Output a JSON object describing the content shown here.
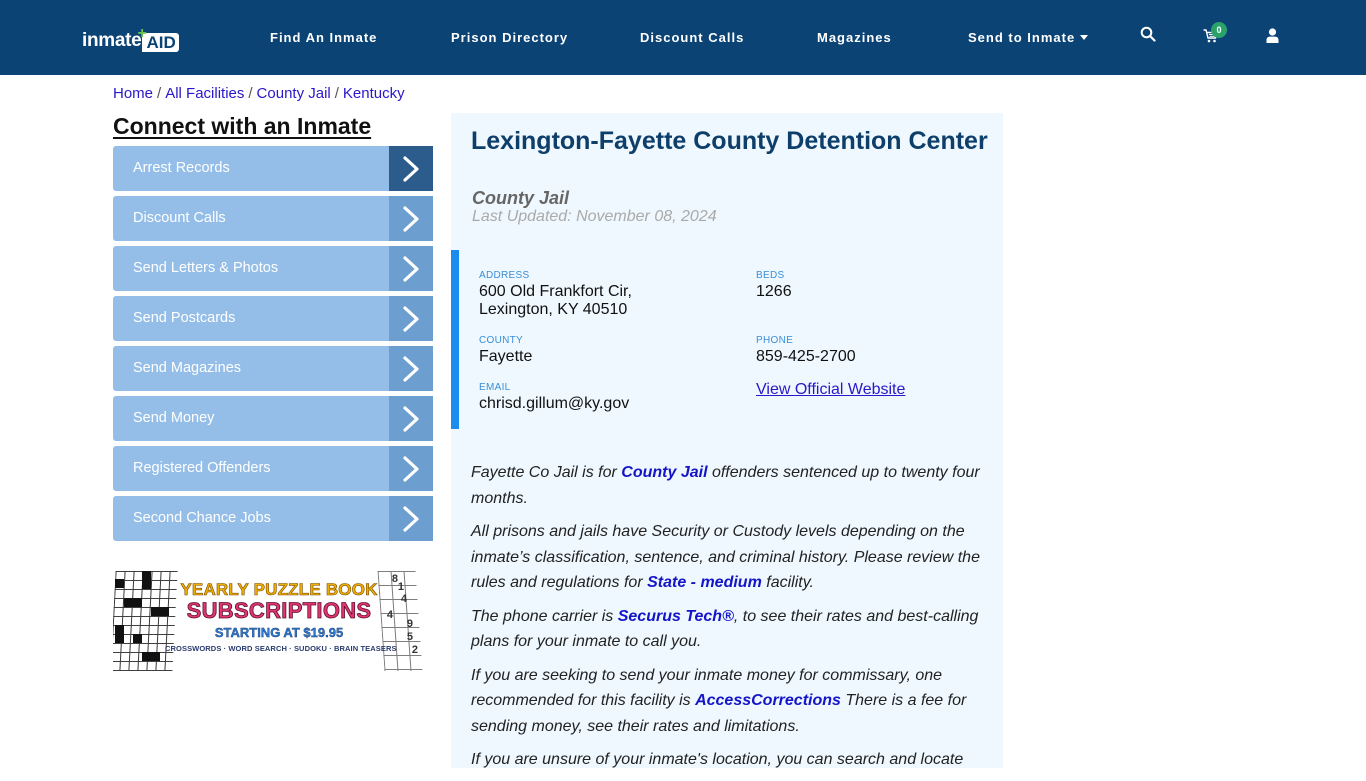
{
  "header": {
    "logo": {
      "part1": "inmate",
      "part2": "AID",
      "plus": "+"
    },
    "nav": [
      {
        "label": "Find An Inmate"
      },
      {
        "label": "Prison Directory"
      },
      {
        "label": "Discount Calls"
      },
      {
        "label": "Magazines"
      },
      {
        "label": "Send to Inmate",
        "has_dropdown": true
      }
    ],
    "icons": {
      "search": "search-icon",
      "cart": "cart-icon",
      "user": "user-icon"
    },
    "cart_count": "0",
    "colors": {
      "bar": "#0b4375",
      "badge": "#2aa36b"
    }
  },
  "breadcrumb": [
    {
      "label": "Home"
    },
    {
      "label": "All Facilities"
    },
    {
      "label": "County Jail"
    },
    {
      "label": "Kentucky"
    }
  ],
  "breadcrumb_separator": "/",
  "sidebar": {
    "title": "Connect with an Inmate",
    "items": [
      {
        "label": "Arrest Records",
        "active": true
      },
      {
        "label": "Discount Calls"
      },
      {
        "label": "Send Letters & Photos"
      },
      {
        "label": "Send Postcards"
      },
      {
        "label": "Send Magazines"
      },
      {
        "label": "Send Money"
      },
      {
        "label": "Registered Offenders"
      },
      {
        "label": "Second Chance Jobs"
      }
    ],
    "banner": {
      "line1": "YEARLY PUZZLE BOOK",
      "line2": "SUBSCRIPTIONS",
      "line3": "STARTING AT $19.95",
      "line4": "CROSSWORDS · WORD SEARCH · SUDOKU · BRAIN TEASERS",
      "sudoku_numbers": [
        "8",
        "1",
        "4",
        "4",
        "9",
        "5",
        "2"
      ]
    }
  },
  "facility": {
    "name": "Lexington-Fayette County Detention Center",
    "type": "County Jail",
    "last_updated": "Last Updated: November 08, 2024",
    "fields": {
      "address_label": "ADDRESS",
      "address_line1": "600 Old Frankfort Cir,",
      "address_line2": "Lexington, KY 40510",
      "beds_label": "BEDS",
      "beds": "1266",
      "county_label": "COUNTY",
      "county": "Fayette",
      "phone_label": "PHONE",
      "phone": "859-425-2700",
      "email_label": "EMAIL",
      "email": "chrisd.gillum@ky.gov",
      "website_link": "View Official Website"
    }
  },
  "body": {
    "p1": {
      "before": "Fayette Co Jail is for ",
      "link": "County Jail",
      "after": " offenders sentenced up to twenty four months."
    },
    "p2": {
      "before": "All prisons and jails have Security or Custody levels depending on the inmate’s classification, sentence, and criminal history. Please review the rules and regulations for ",
      "link": "State - medium",
      "after": " facility."
    },
    "p3": {
      "before": "The phone carrier is ",
      "link": "Securus Tech®",
      "after": ", to see their rates and best-calling plans for your inmate to call you."
    },
    "p4": {
      "before": "If you are seeking to send your inmate money for commissary, one recommended for this facility is ",
      "link": "AccessCorrections",
      "after": " There is a fee for sending money, see their rates and limitations."
    },
    "p5": {
      "before": "If you are unsure of your inmate's location, you can search and locate"
    }
  }
}
